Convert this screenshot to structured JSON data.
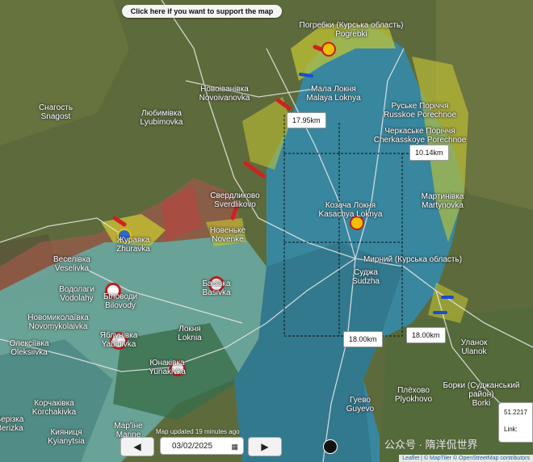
{
  "banner": {
    "text": "Click here if you want to support the map"
  },
  "cities": [
    {
      "id": "pogrebki",
      "text": "Погребки (Курська область)\nPogrebki"
    },
    {
      "id": "novoivanovka",
      "text": "Новоіванівка\nNovoivanovka"
    },
    {
      "id": "snagost",
      "text": "Снагость\nSnagost"
    },
    {
      "id": "lyubimovka",
      "text": "Любимівка\nLyubimovka"
    },
    {
      "id": "malaya-loknya",
      "text": "Мала Локня\nMalaya Loknya"
    },
    {
      "id": "russkoe-porechnoe",
      "text": "Руське Поріччя\nRusskoe Porechnoe"
    },
    {
      "id": "cherkasskoye-porechnoe",
      "text": "Черкаське Поріччя\nCherkasskoye Porechnoe"
    },
    {
      "id": "sverdlikovo",
      "text": "Свердликово\nSverdlikovo"
    },
    {
      "id": "kazachya-loknya",
      "text": "Козача Локня\nKasachya Loknya"
    },
    {
      "id": "martynovka",
      "text": "Мартинівка\nMartynovka"
    },
    {
      "id": "novenke",
      "text": "Новеньке\nNovenke"
    },
    {
      "id": "zhuravka",
      "text": "Журавка\nZhuravka"
    },
    {
      "id": "veselivka",
      "text": "Веселівка\nVeselivka"
    },
    {
      "id": "mirny",
      "text": "Мирний (Курська область)"
    },
    {
      "id": "sudzha",
      "text": "Суджа\nSudzha"
    },
    {
      "id": "vodolahy",
      "text": "Водолаги\nVodolahy"
    },
    {
      "id": "bilovody",
      "text": "Біловоди\nBilovody"
    },
    {
      "id": "basivka",
      "text": "Басівка\nBasivka"
    },
    {
      "id": "novomykolaivka",
      "text": "Новомиколаївка\nNovomykolaivka"
    },
    {
      "id": "oleksiivka",
      "text": "Олексіївка\nOleksiivka"
    },
    {
      "id": "yablunivka",
      "text": "Яблунівка\nYabluivka"
    },
    {
      "id": "loknia",
      "text": "Локня\nLoknia"
    },
    {
      "id": "yunakivka",
      "text": "Юнаківка\nYunakivka"
    },
    {
      "id": "ulanok",
      "text": "Уланок\nUlanok"
    },
    {
      "id": "borki",
      "text": "Борки (Суджанський\nрайон)\nBorki"
    },
    {
      "id": "plyokhovo",
      "text": "Плёхово\nPlyokhovo"
    },
    {
      "id": "guyevo",
      "text": "Гуево\nGuyevo"
    },
    {
      "id": "korchakivka",
      "text": "Корчаківка\nKorchakivka"
    },
    {
      "id": "kiyanytsia",
      "text": "Кияниця\nKyianytsia"
    },
    {
      "id": "marine",
      "text": "Мар'їне\nMarine"
    },
    {
      "id": "berizka",
      "text": "Берізка\nBerizka"
    }
  ],
  "distances": [
    {
      "id": "d1",
      "text": "17.95km"
    },
    {
      "id": "d2",
      "text": "10.14km"
    },
    {
      "id": "d3",
      "text": "18.00km"
    },
    {
      "id": "d4",
      "text": "18.00km"
    }
  ],
  "footer": {
    "updated": "Map updated 19 minutes ago",
    "date": "03/02/2025",
    "prev": "◀",
    "next": "▶",
    "coord": "51.2217",
    "link_label": "Link:",
    "attribution": "Leaflet | © MapTiler © OpenStreetMap contributors",
    "watermark": "公众号 · 隋洋侃世界"
  },
  "colors": {
    "occupied_blue": "#2f8fb8",
    "contested_yellow": "#c8c832",
    "ua_red": "#c04040"
  }
}
